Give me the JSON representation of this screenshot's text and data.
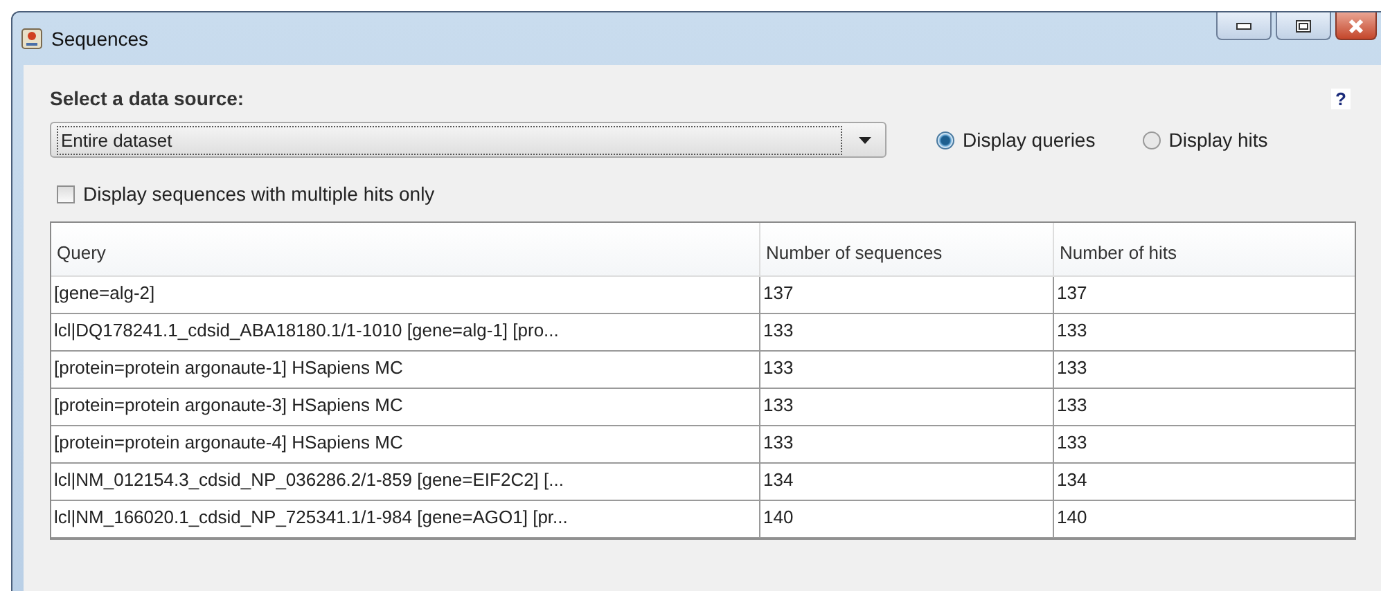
{
  "window": {
    "title": "Sequences"
  },
  "source": {
    "label": "Select a data source:",
    "value": "Entire dataset",
    "help": "?"
  },
  "display_mode": [
    {
      "label": "Display queries",
      "selected": true
    },
    {
      "label": "Display hits",
      "selected": false
    }
  ],
  "multiple_hits_only": {
    "label": "Display sequences with multiple hits only",
    "checked": false
  },
  "table": {
    "columns": [
      "Query",
      "Number of sequences",
      "Number of hits"
    ],
    "rows": [
      [
        "[gene=alg-2]",
        "137",
        "137"
      ],
      [
        "lcl|DQ178241.1_cdsid_ABA18180.1/1-1010 [gene=alg-1] [pro...",
        "133",
        "133"
      ],
      [
        "[protein=protein argonaute-1] HSapiens MC",
        "133",
        "133"
      ],
      [
        "[protein=protein argonaute-3] HSapiens MC",
        "133",
        "133"
      ],
      [
        "[protein=protein argonaute-4] HSapiens MC",
        "133",
        "133"
      ],
      [
        "lcl|NM_012154.3_cdsid_NP_036286.2/1-859 [gene=EIF2C2] [...",
        "134",
        "134"
      ],
      [
        "lcl|NM_166020.1_cdsid_NP_725341.1/1-984 [gene=AGO1] [pr...",
        "140",
        "140"
      ]
    ]
  }
}
